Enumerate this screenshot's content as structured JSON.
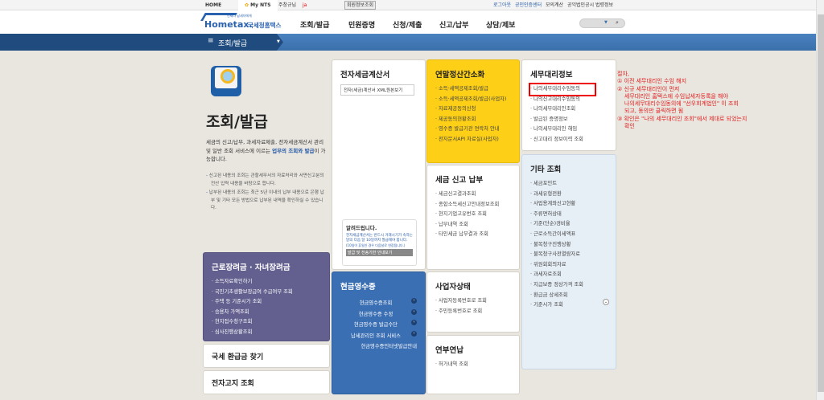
{
  "topbar": {
    "home": "HOME",
    "mynts": "My NTS",
    "user": "주창규님",
    "user_id": "ja",
    "member_info": "회원정보조회",
    "logout": "로그아웃",
    "cert_center": "공인인증센터",
    "links": [
      "모의계산",
      "공익법인공시",
      "법령정보"
    ]
  },
  "header": {
    "logo_text": "Hometax.",
    "logo_kr": "국세청홈택스",
    "logo_tagline": "언제나 납세자에게",
    "nav": [
      "조회/발급",
      "민원증명",
      "신청/제출",
      "신고/납부",
      "상담/제보"
    ]
  },
  "band": {
    "menu_label": "조회/발급"
  },
  "intro": {
    "title": "조회/발급",
    "desc1": "세금의 신고/납부, 과세자료제출, 전자세금계산서 관리 및 일반 조회 서비스에 이르는 ",
    "desc_highlight": "업무의 조회와 발급",
    "desc2": "이 가능합니다.",
    "bullets": [
      "신고된 내용의 조회는 관할세무서의 자료처리와 서면신고분의 전산 입력 내용을 바탕으로 합니다.",
      "납부된 내용의 조회는 최근 5년 이내의 납부 내용으로 은행 납부 및 기타 모든 방법으로 납부된 내역을 확인하실 수 있습니다."
    ]
  },
  "etax": {
    "title": "전자세금계산서",
    "button": "전자(세금)계산서 XML원본보기",
    "notice_title": "알려드립니다.",
    "notice_text": "전자세금계산서는 반드시 거래시기가 속하는 달의 다음 달 10일까지 발급해야 합니다.",
    "notice_sub": "(10일이 휴일인 경우 다음날로 연장됩니다.)",
    "notice_button": "발급 및 전송기한 안내보기"
  },
  "yearend": {
    "title": "연말정산간소화",
    "items": [
      "소득·세액공제조회/발급",
      "소득·세액공제조회/발급(사업자)",
      "자료제공동의신청",
      "제공동의현황조회",
      "영수증 발급기관 연락처 안내",
      "전자문서API 자료실(사업자)"
    ]
  },
  "agent": {
    "title": "세무대리정보",
    "items": [
      "나의세무대리수임동의",
      "나의신고대리수임동의",
      "나의세무대리인조회",
      "발급된 증명정보",
      "나의세무대리인 해임",
      "신고대리 정보이력 조회"
    ]
  },
  "tax": {
    "title": "세금 신고 납부",
    "items": [
      "세금신고결과조회",
      "종합소득세신고안내정보조회",
      "현지기업고유번호 조회",
      "납부내역 조회",
      "타인세금 납부결과 조회"
    ]
  },
  "other": {
    "title": "기타 조회",
    "items": [
      "세금포인트",
      "과세유형전환",
      "사업용계좌신고현황",
      "주류면허상태",
      "기준(단순)경비율",
      "근로소득간이세액표",
      "불복청구진행상황",
      "불복청구사전열람자료",
      "위원회회의자료",
      "과세자료조회",
      "지급보증 정상가격 조회",
      "환급금 상세조회",
      "기준시가 조회"
    ]
  },
  "eitc": {
    "title": "근로장려금 · 자녀장려금",
    "items": [
      "소득자료확인하기",
      "국민기초생활보장급여 수급여부 조회",
      "주택 등 기준시가 조회",
      "승용차 가액조회",
      "현지접수청구조회",
      "심사진행상황조회"
    ]
  },
  "refund": {
    "title": "국세 환급금 찾기"
  },
  "enotice": {
    "title": "전자고지 조회"
  },
  "cash": {
    "title": "현금영수증",
    "items": [
      "현금영수증조회",
      "현금영수증 수정",
      "현금영수증 발급수단",
      "납세관리인 조회 서비스",
      "현금영수증인터넷발급안내"
    ]
  },
  "biz": {
    "title": "사업자상태",
    "items": [
      "사업자등록번호로 조회",
      "주민등록번호로 조회"
    ]
  },
  "install": {
    "title": "연부연납",
    "items": [
      "허가내역 조회"
    ]
  },
  "annotation": "절차,\n① 이전 세무대리인 수임 해지\n② 신규 세무대리인이 먼저\n    세무대리인 홈택스에 수임납세자등록을 해야\n    나의세무대리수임동의에 \"선우회계법인\" 이 조회\n    되고, 동의만 클릭하면 됨\n③ 확인은 \"나의 세무대리인 조회\"에서 제대로 되었는지\n    확인"
}
